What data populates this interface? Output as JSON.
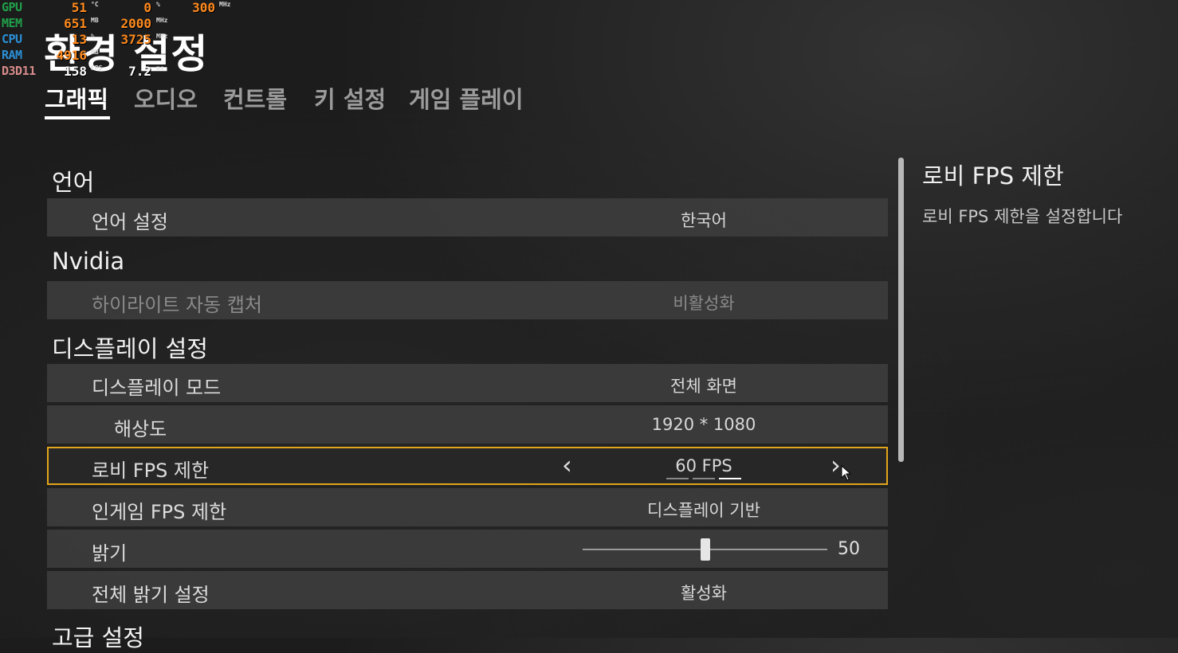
{
  "osd": {
    "gpu": {
      "label": "GPU",
      "label_color": "#21a04a",
      "v1": "51",
      "u1": "°C",
      "v2": "0",
      "u2": "%",
      "v3": "300",
      "u3": "MHz"
    },
    "mem": {
      "label": "MEM",
      "label_color": "#21a04a",
      "v1": "651",
      "u1": "MB",
      "v2": "2000",
      "u2": "MHz"
    },
    "cpu": {
      "label": "CPU",
      "label_color": "#2b8fd6",
      "v1": "13",
      "u1": "%",
      "v2": "3725",
      "u2": "MHz"
    },
    "ram": {
      "label": "RAM",
      "label_color": "#2b8fd6",
      "v1": "4916",
      "u1": "MB"
    },
    "d3d": {
      "label": "D3D11",
      "label_color": "#d68a8a",
      "v1": "158",
      "u1": "FPS",
      "v2": "7.2",
      "u2": "ms"
    }
  },
  "page_title": "환경 설정",
  "tabs": [
    "그래픽",
    "오디오",
    "컨트롤",
    "키 설정",
    "게임 플레이"
  ],
  "active_tab": "그래픽",
  "sections": {
    "language": "언어",
    "nvidia": "Nvidia",
    "display": "디스플레이 설정",
    "advanced": "고급 설정"
  },
  "rows": {
    "language": {
      "label": "언어 설정",
      "value": "한국어"
    },
    "highlight": {
      "label": "하이라이트 자동 캡처",
      "value": "비활성화"
    },
    "display_mode": {
      "label": "디스플레이 모드",
      "value": "전체 화면"
    },
    "resolution": {
      "label": "해상도",
      "value": "1920 * 1080"
    },
    "lobby_fps": {
      "label": "로비 FPS 제한",
      "value": "60 FPS",
      "prev": "‹",
      "next": "›"
    },
    "ingame_fps": {
      "label": "인게임 FPS 제한",
      "value": "디스플레이 기반"
    },
    "brightness": {
      "label": "밝기",
      "value": "50",
      "level": 0.5
    },
    "global_brightness": {
      "label": "전체 밝기 설정",
      "value": "활성화"
    }
  },
  "description": {
    "title": "로비 FPS 제한",
    "text": "로비 FPS 제한을 설정합니다"
  },
  "colors": {
    "selection_border": "#e2a41a",
    "osd_value": "#ff8a1e"
  }
}
